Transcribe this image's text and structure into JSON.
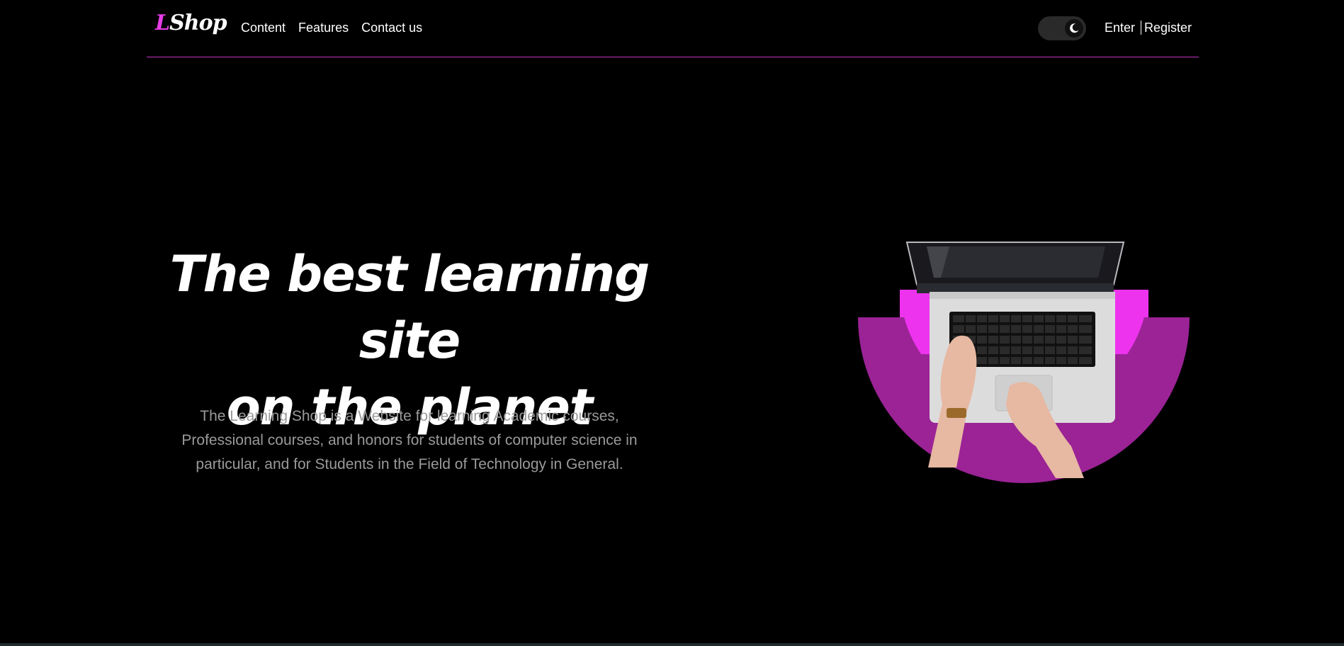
{
  "navbar": {
    "logo": {
      "first_letter": "L",
      "rest": "Shop"
    },
    "links": [
      {
        "label": "Content"
      },
      {
        "label": "Features"
      },
      {
        "label": "Contact us"
      }
    ],
    "theme_toggle": {
      "icon": "moon-icon",
      "state": "dark"
    },
    "auth": {
      "enter_label": "Enter",
      "register_label": "Register"
    }
  },
  "hero": {
    "title_line1": "The best learning site",
    "title_line2": "on the planet",
    "description_line1": "The Learning Shop is a Website for learning Academic courses,",
    "description_line2": "Professional courses, and honors for students of computer science in",
    "description_line3": "particular, and for Students in the Field of Technology in General.",
    "image": "laptop-typing-illustration"
  },
  "colors": {
    "background": "#000000",
    "accent": "#e63de6",
    "accent_dark": "#9b2396",
    "navbar_border": "#c434c4",
    "body_text": "#9a9a9a"
  }
}
